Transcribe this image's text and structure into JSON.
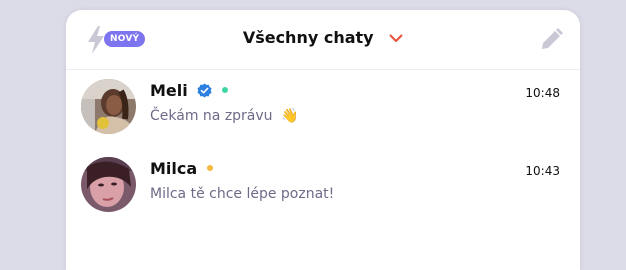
{
  "header": {
    "badge": "NOVÝ",
    "title": "Všechny chaty",
    "icons": [
      "bolt-icon",
      "chevron-down-icon",
      "pencil-icon"
    ],
    "accent": "#7d74ef",
    "chevron_color": "#e8503a"
  },
  "chats": [
    {
      "name": "Meli",
      "verified": true,
      "status_color": "#3ed6a0",
      "time": "10:48",
      "message": "Čekám na zprávu",
      "message_emoji": "👋"
    },
    {
      "name": "Milca",
      "verified": false,
      "status_color": "#f5b942",
      "time": "10:43",
      "message": "Milca tě chce lépe poznat!"
    }
  ]
}
